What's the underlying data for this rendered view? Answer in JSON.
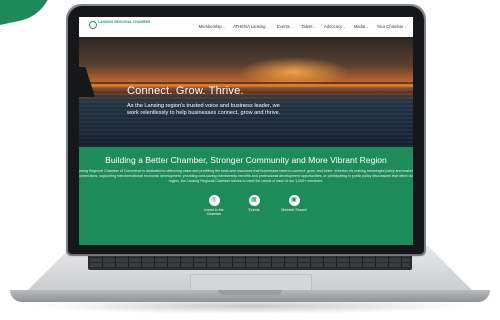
{
  "site": {
    "logo_text": "LANSING REGIONAL CHAMBER",
    "nav": [
      {
        "label": "Membership"
      },
      {
        "label": "ATHENA Lansing"
      },
      {
        "label": "Events"
      },
      {
        "label": "Talent"
      },
      {
        "label": "Advocacy"
      },
      {
        "label": "Media"
      },
      {
        "label": "Your Chamber"
      }
    ]
  },
  "hero": {
    "title": "Connect. Grow. Thrive.",
    "text": "As the Lansing region's trusted voice and business leader, we work relentlessly to help businesses connect, grow and thrive."
  },
  "about": {
    "title": "Building a Better Chamber, Stronger Community and More Vibrant Region",
    "text": "Lansing Regional Chamber of Commerce is dedicated to delivering value and providing the tools and resources that businesses need to connect, grow, and thrive. Whether it's making meaningful policy and business connections, supporting transformational economic development, providing cost-saving membership benefits and professional development opportunities, or participating in public policy discussions that affect our region, the Lansing Regional Chamber strives to meet the needs of each of our 1,000+ members.",
    "cards": [
      {
        "label": "Invest in the Chamber",
        "icon": "invest-icon",
        "glyph": "◎"
      },
      {
        "label": "Events",
        "icon": "calendar-icon",
        "glyph": "▦"
      },
      {
        "label": "Member Search",
        "icon": "member-search-icon",
        "glyph": "▣"
      }
    ]
  },
  "colors": {
    "brand_green": "#1d8c5a",
    "corner_accent": "#1e8a5a"
  }
}
